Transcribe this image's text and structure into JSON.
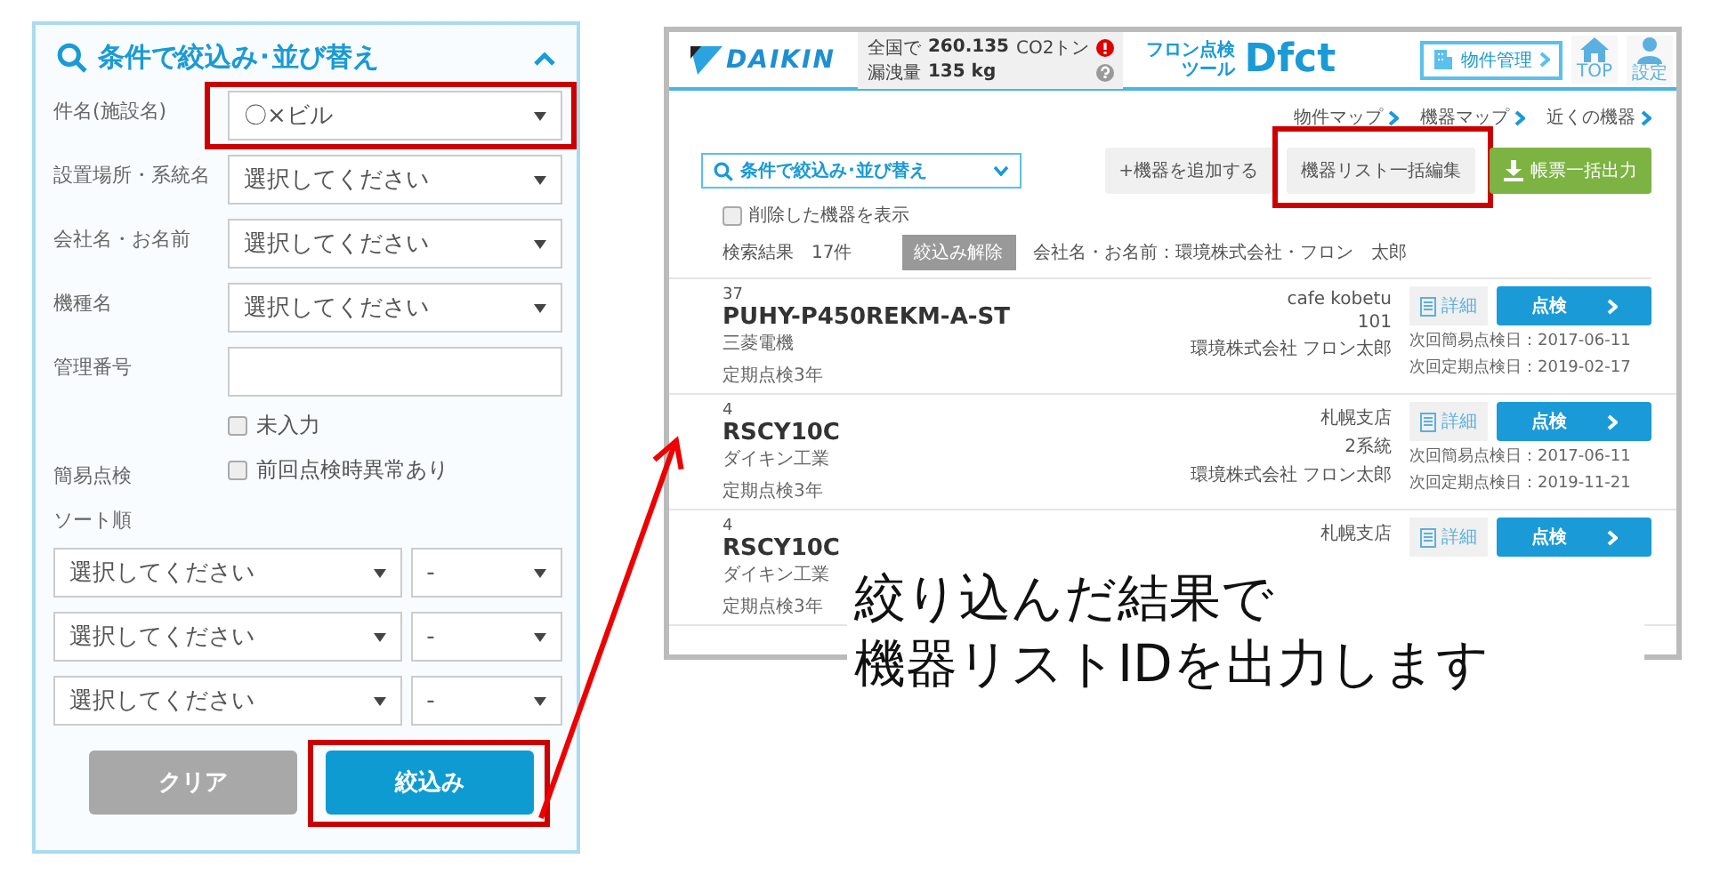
{
  "filter_panel": {
    "title": "条件で絞込み･並び替え",
    "expanded": true,
    "fields": [
      {
        "kind": "select",
        "label": "件名(施設名)",
        "value": "〇×ビル",
        "highlighted": true
      },
      {
        "kind": "select",
        "label": "設置場所・系統名",
        "value": "選択してください",
        "highlighted": false
      },
      {
        "kind": "select",
        "label": "会社名・お名前",
        "value": "選択してください",
        "highlighted": false
      },
      {
        "kind": "select",
        "label": "機種名",
        "value": "選択してください",
        "highlighted": false
      },
      {
        "kind": "text",
        "label": "管理番号",
        "highlighted": false
      },
      {
        "kind": "checkbox",
        "option": "未入力",
        "checked": false
      },
      {
        "kind": "checkbox",
        "label": "簡易点検",
        "option": "前回点検時異常あり",
        "checked": false
      }
    ],
    "sort": {
      "label": "ソート順",
      "rows": [
        {
          "key": "選択してください",
          "order": "-"
        },
        {
          "key": "選択してください",
          "order": "-"
        },
        {
          "key": "選択してください",
          "order": "-"
        }
      ]
    },
    "buttons": [
      {
        "label": "クリア",
        "kind": "secondary",
        "highlighted": false
      },
      {
        "label": "絞込み",
        "kind": "primary",
        "highlighted": true
      }
    ]
  },
  "app": {
    "header": {
      "logo": "DAIKIN",
      "stats": [
        {
          "label": "全国で",
          "value": "260.135",
          "unit": "CO2トン"
        },
        {
          "label": "漏洩量",
          "value": "135 kg"
        }
      ],
      "tool_label": [
        "フロン点検",
        "ツール"
      ],
      "tool_name": "Dfct",
      "property_button": "物件管理",
      "nav": [
        {
          "label": "TOP",
          "kind": "home"
        },
        {
          "label": "設定",
          "kind": "person"
        }
      ]
    },
    "links": [
      "物件マップ",
      "機器マップ",
      "近くの機器"
    ],
    "filter_dropdown": "条件で絞込み･並び替え",
    "toolbar": [
      {
        "label": "+機器を追加する",
        "kind": "plain",
        "highlighted": false
      },
      {
        "label": "機器リスト一括編集",
        "kind": "plain",
        "highlighted": true
      },
      {
        "label": "帳票一括出力",
        "kind": "export",
        "highlighted": false
      }
    ],
    "show_deleted": {
      "label": "削除した機器を表示",
      "checked": false
    },
    "results": {
      "label": "検索結果",
      "count": "17件",
      "clear_button": "絞込み解除",
      "condition": "会社名・お名前：環境株式会社・フロン　太郎"
    },
    "rows": [
      {
        "number": "37",
        "model": "PUHY-P450REKM-A-ST",
        "maker": "三菱電機",
        "cycle": "定期点検3年",
        "site": "cafe kobetu",
        "system": "101",
        "owner": "環境株式会社 フロン太郎",
        "detail_button": "詳細",
        "inspect_button": "点検",
        "dates": [
          "次回簡易点検日：2017-06-11",
          "次回定期点検日：2019-02-17"
        ]
      },
      {
        "number": "4",
        "model": "RSCY10C",
        "maker": "ダイキン工業",
        "cycle": "定期点検3年",
        "site": "札幌支店",
        "system": "2系統",
        "owner": "環境株式会社 フロン太郎",
        "detail_button": "詳細",
        "inspect_button": "点検",
        "dates": [
          "次回簡易点検日：2017-06-11",
          "次回定期点検日：2019-11-21"
        ]
      },
      {
        "number": "4",
        "model": "RSCY10C",
        "maker": "ダイキン工業",
        "cycle": "定期点検3年",
        "site": "札幌支店",
        "detail_button": "詳細",
        "inspect_button": "点検"
      }
    ]
  },
  "caption": [
    "絞り込んだ結果で",
    "機器リストIDを出力します"
  ]
}
